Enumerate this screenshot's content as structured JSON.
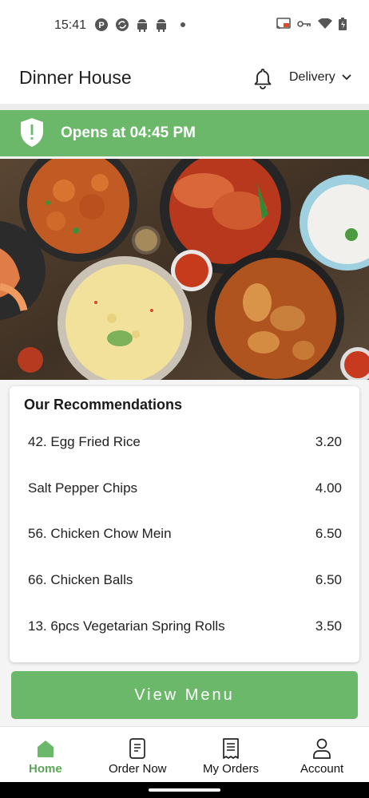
{
  "status_bar": {
    "time": "15:41"
  },
  "app_bar": {
    "title": "Dinner House",
    "delivery_label": "Delivery"
  },
  "banner": {
    "text": "Opens at 04:45 PM",
    "color": "#6cb86a"
  },
  "recommendations": {
    "title": "Our Recommendations",
    "items": [
      {
        "name": "42. Egg Fried Rice",
        "price": "3.20"
      },
      {
        "name": "Salt Pepper Chips",
        "price": "4.00"
      },
      {
        "name": "56. Chicken Chow Mein",
        "price": "6.50"
      },
      {
        "name": "66. Chicken Balls",
        "price": "6.50"
      },
      {
        "name": "13. 6pcs Vegetarian Spring Rolls",
        "price": "3.50"
      }
    ]
  },
  "view_menu_label": "View Menu",
  "nav": {
    "home": "Home",
    "order_now": "Order Now",
    "my_orders": "My Orders",
    "account": "Account"
  },
  "colors": {
    "accent": "#6cb86a",
    "active_nav": "#5aa857"
  }
}
